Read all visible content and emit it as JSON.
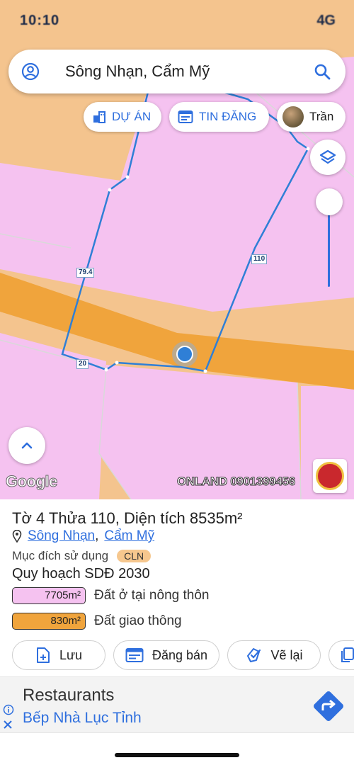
{
  "status_bar": {
    "time": "10:10",
    "indicators": "4G"
  },
  "search": {
    "query": "Sông Nhạn, Cẩm Mỹ"
  },
  "chips": {
    "du_an": "DỰ ÁN",
    "tin_dang": "TIN ĐĂNG",
    "user": "Trần"
  },
  "map": {
    "edge_labels": [
      "79.4",
      "110",
      "20"
    ],
    "google_logo": "Google",
    "watermark": "ONLAND 0901399456",
    "colors": {
      "residential": "#f5c2f0",
      "road": "#f0a43c",
      "background": "#f4c48e",
      "boundary": "#2f7fd6"
    }
  },
  "parcel": {
    "title": "Tờ 4 Thửa 110, Diện tích 8535m²",
    "location": {
      "commune": "Sông Nhạn",
      "separator": ",",
      "district": "Cẩm Mỹ"
    },
    "purpose_label": "Mục đích sử dụng",
    "purpose_code": "CLN",
    "plan_title": "Quy hoạch SDĐ 2030",
    "land_uses": [
      {
        "area": "7705m²",
        "name": "Đất ở tại nông thôn",
        "color": "#f5c2f0"
      },
      {
        "area": "830m²",
        "name": "Đất giao thông",
        "color": "#f0a43c"
      }
    ]
  },
  "actions": {
    "save": "Lưu",
    "sell": "Đăng bán",
    "redraw": "Vẽ lại"
  },
  "ad": {
    "title": "Restaurants",
    "subtitle": "Bếp Nhà Lục Tỉnh"
  }
}
